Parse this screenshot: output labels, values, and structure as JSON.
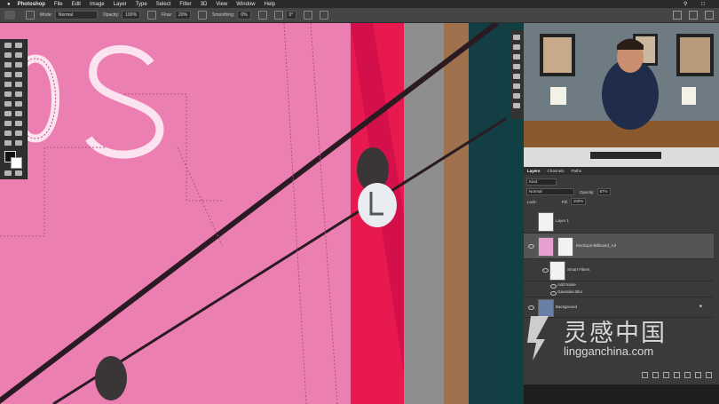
{
  "menubar": {
    "apple_icon": "apple-icon",
    "app": "Photoshop",
    "items": [
      "File",
      "Edit",
      "Image",
      "Layer",
      "Type",
      "Select",
      "Filter",
      "3D",
      "View",
      "Window",
      "Help"
    ]
  },
  "options": {
    "mode_label": "Mode:",
    "mode_value": "Normal",
    "opacity_label": "Opacity:",
    "opacity_value": "100%",
    "flow_label": "Flow:",
    "flow_value": "20%",
    "smoothing_label": "Smoothing:",
    "smoothing_value": "0%",
    "angle_value": "0°"
  },
  "layers_panel": {
    "tabs": [
      "Layers",
      "Channels",
      "Paths"
    ],
    "kind_filter": "Kind",
    "blend_mode": "Normal",
    "opacity_label": "Opacity:",
    "opacity_value": "87%",
    "lock_label": "Lock:",
    "fill_label": "Fill:",
    "fill_value": "100%",
    "layers": [
      {
        "name": "Layer 1"
      },
      {
        "name": "Mockups-Billboard_Ad"
      },
      {
        "name": "Smart Filters"
      },
      {
        "name": "Add Noise"
      },
      {
        "name": "Gaussian Blur"
      },
      {
        "name": "Background"
      }
    ]
  },
  "watermark": {
    "chinese": "灵感中国",
    "url": "lingganchina.com"
  },
  "colors": {
    "canvas_pink": "#ec7fb2",
    "billboard_red": "#e8194f",
    "panel_bg": "#3a3a3a"
  }
}
